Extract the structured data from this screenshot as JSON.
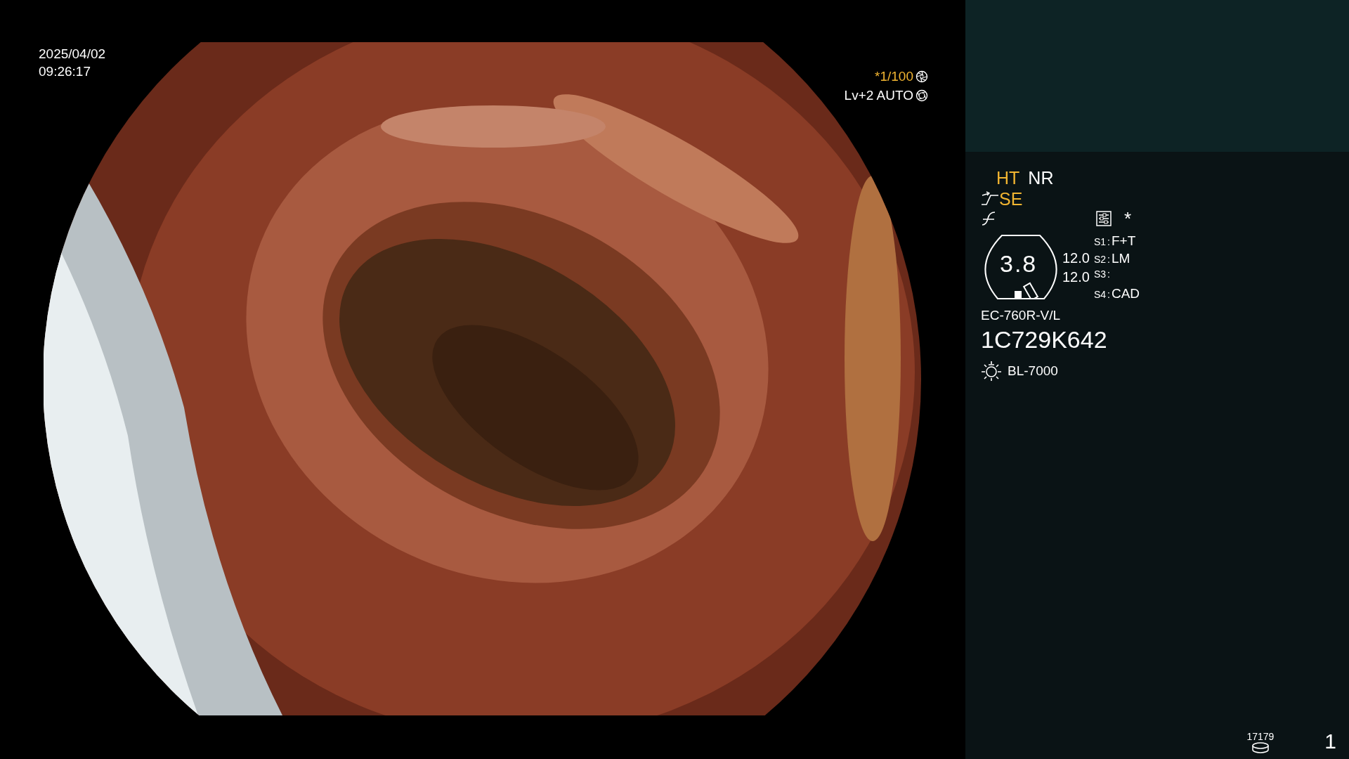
{
  "overlay": {
    "date": "2025/04/02",
    "time": "09:26:17",
    "shutter": {
      "text": "*1/100",
      "highlighted": true
    },
    "exposure": {
      "text": "Lv+2 AUTO",
      "highlighted": false
    }
  },
  "side_panel": {
    "modes": [
      {
        "label": "HT",
        "active": true
      },
      {
        "label": "NR",
        "active": false
      }
    ],
    "enhance": {
      "label": "SE",
      "active": true
    },
    "asterisk": "*",
    "zoom": "3.8",
    "values": [
      "12.0",
      "12.0"
    ],
    "switches": [
      {
        "key": "S1",
        "sep": ":",
        "value": "F+T"
      },
      {
        "key": "S2",
        "sep": ":",
        "value": "LM"
      },
      {
        "key": "S3",
        "sep": ":"
      },
      {
        "key": "S4",
        "sep": ":",
        "value": "CAD"
      }
    ],
    "scope_model": "EC-760R-V/L",
    "scope_serial": "1C729K642",
    "light_source": "BL-7000",
    "storage_count": "17179",
    "page_number": "1"
  }
}
